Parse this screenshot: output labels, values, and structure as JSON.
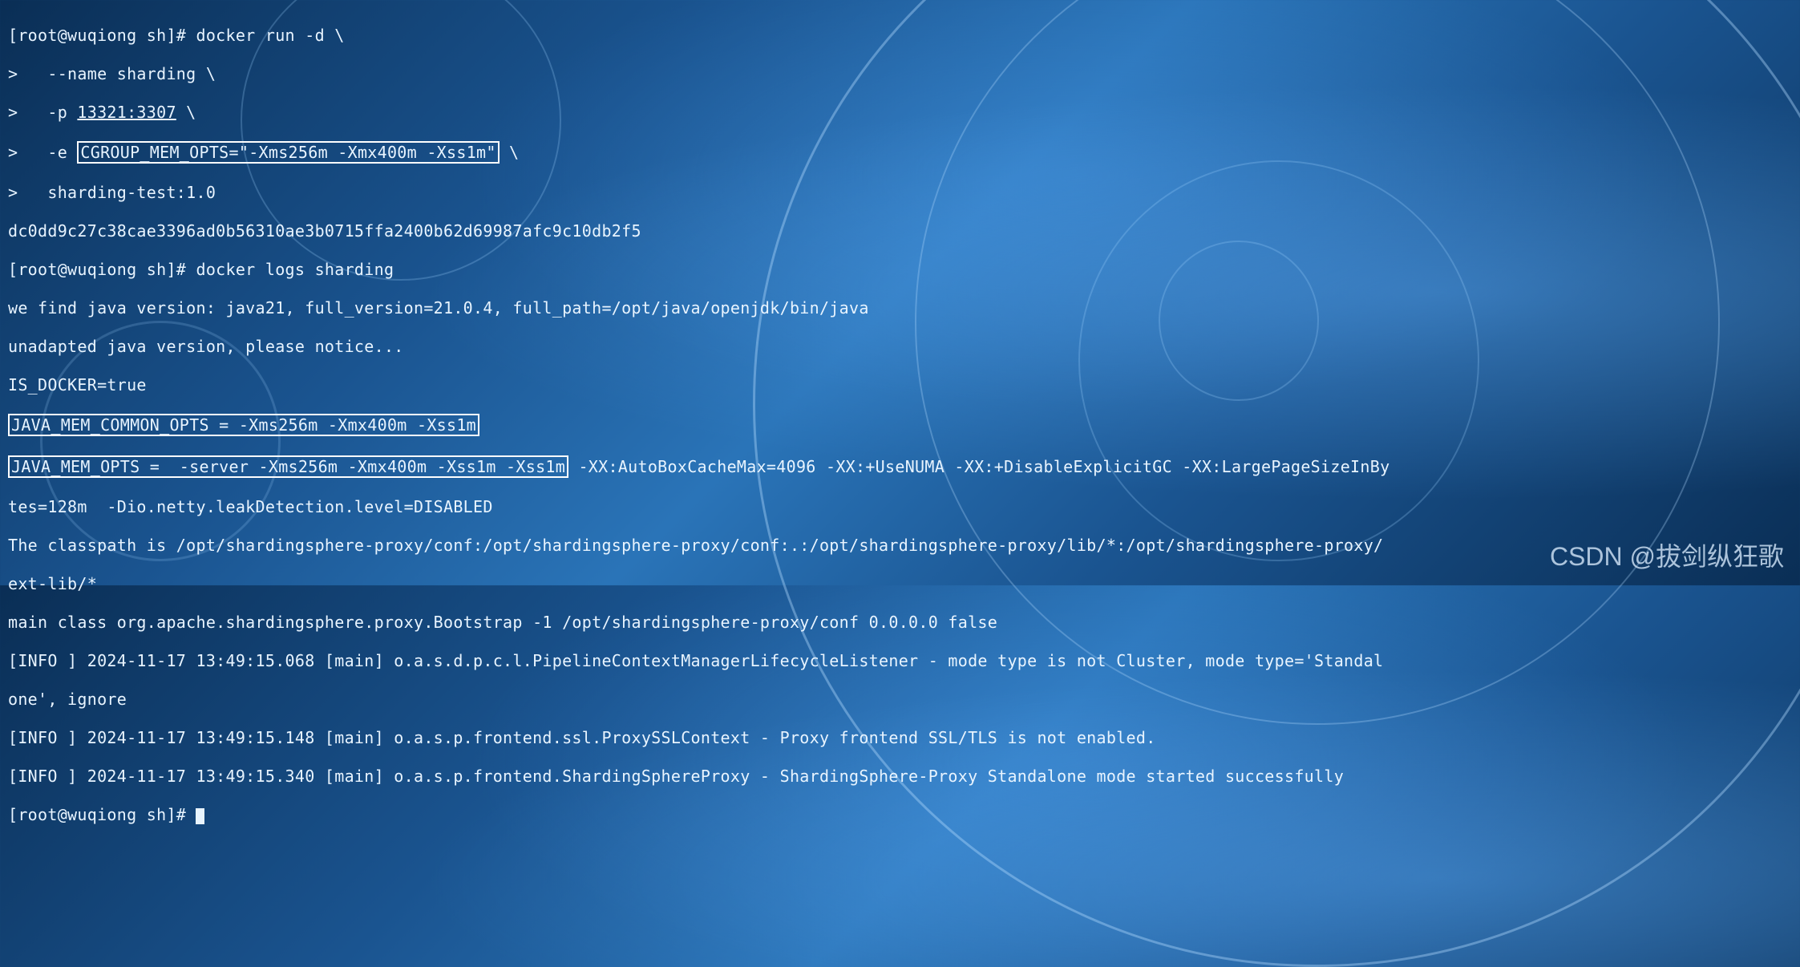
{
  "lines": {
    "l0_prefix": "[root@wuqiong sh]# docker run -d \\",
    "l1": ">   --name sharding \\",
    "l2_a": ">   -p ",
    "l2_b": "13321:3307",
    "l2_c": " \\",
    "l3_a": ">   -e ",
    "l3_box": "CGROUP_MEM_OPTS=\"-Xms256m -Xmx400m -Xss1m\"",
    "l3_c": " \\",
    "l4": ">   sharding-test:1.0",
    "l5": "dc0dd9c27c38cae3396ad0b56310ae3b0715ffa2400b62d69987afc9c10db2f5",
    "l6": "[root@wuqiong sh]# docker logs sharding",
    "l7": "we find java version: java21, full_version=21.0.4, full_path=/opt/java/openjdk/bin/java",
    "l8": "unadapted java version, please notice...",
    "l9": "IS_DOCKER=true",
    "l10_box": "JAVA_MEM_COMMON_OPTS = -Xms256m -Xmx400m -Xss1m",
    "l11_box": "JAVA_MEM_OPTS =  -server -Xms256m -Xmx400m -Xss1m -Xss1m",
    "l11_rest": " -XX:AutoBoxCacheMax=4096 -XX:+UseNUMA -XX:+DisableExplicitGC -XX:LargePageSizeInBy",
    "l12": "tes=128m  -Dio.netty.leakDetection.level=DISABLED",
    "l13": "The classpath is /opt/shardingsphere-proxy/conf:/opt/shardingsphere-proxy/conf:.:/opt/shardingsphere-proxy/lib/*:/opt/shardingsphere-proxy/",
    "l14": "ext-lib/*",
    "l15": "main class org.apache.shardingsphere.proxy.Bootstrap -1 /opt/shardingsphere-proxy/conf 0.0.0.0 false",
    "l16": "[INFO ] 2024-11-17 13:49:15.068 [main] o.a.s.d.p.c.l.PipelineContextManagerLifecycleListener - mode type is not Cluster, mode type='Standal",
    "l17": "one', ignore",
    "l18": "[INFO ] 2024-11-17 13:49:15.148 [main] o.a.s.p.frontend.ssl.ProxySSLContext - Proxy frontend SSL/TLS is not enabled.",
    "l19": "[INFO ] 2024-11-17 13:49:15.340 [main] o.a.s.p.frontend.ShardingSphereProxy - ShardingSphere-Proxy Standalone mode started successfully",
    "l20": "[root@wuqiong sh]# "
  },
  "watermark": "CSDN @拔剑纵狂歌"
}
